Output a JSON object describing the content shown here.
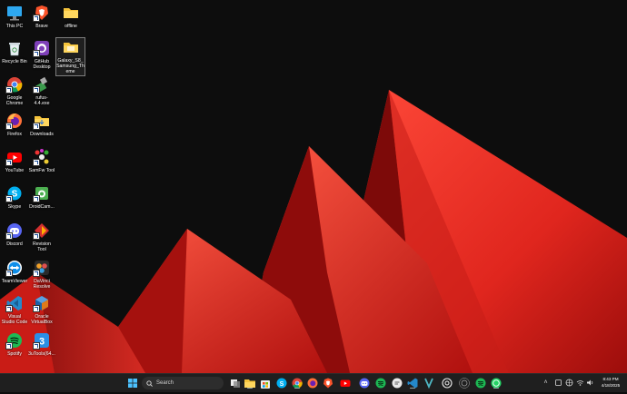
{
  "desktop": {
    "icons": [
      {
        "label": "This PC",
        "icon": "monitor-icon"
      },
      {
        "label": "Brave",
        "icon": "brave-icon"
      },
      {
        "label": "offline",
        "icon": "folder-icon"
      },
      {
        "label": "Recycle Bin",
        "icon": "recycle-bin-icon"
      },
      {
        "label": "GitHub Desktop",
        "icon": "github-icon"
      },
      {
        "label": "Galaxy_S8_Samsung_Theme",
        "icon": "folder-icon"
      },
      {
        "label": "Google Chrome",
        "icon": "chrome-icon"
      },
      {
        "label": "rufus-4.4.exe",
        "icon": "rufus-icon"
      },
      {
        "label": "Firefox",
        "icon": "firefox-icon"
      },
      {
        "label": "Downloads",
        "icon": "folder-icon"
      },
      {
        "label": "YouTube",
        "icon": "youtube-icon"
      },
      {
        "label": "SamFw Tool",
        "icon": "samfw-icon"
      },
      {
        "label": "Skype",
        "icon": "skype-icon"
      },
      {
        "label": "DroidCam...",
        "icon": "droidcam-icon"
      },
      {
        "label": "Discord",
        "icon": "discord-icon"
      },
      {
        "label": "Revision Tool",
        "icon": "revision-tool-icon"
      },
      {
        "label": "TeamViewer",
        "icon": "teamviewer-icon"
      },
      {
        "label": "DaVinci Resolve",
        "icon": "davinci-icon"
      },
      {
        "label": "Visual Studio Code",
        "icon": "vscode-icon"
      },
      {
        "label": "Oracle VirtualBox",
        "icon": "virtualbox-icon"
      },
      {
        "label": "Spotify",
        "icon": "spotify-icon"
      },
      {
        "label": "3uTools(64...",
        "icon": "3utools-icon"
      }
    ]
  },
  "taskbar": {
    "search_placeholder": "Search",
    "pinned": [
      "windows-start-icon",
      "task-view-icon",
      "file-explorer-icon",
      "store-icon",
      "skype-icon",
      "chrome-icon",
      "firefox-icon",
      "brave-icon",
      "youtube-icon",
      "discord-icon",
      "spotify-icon",
      "chat-icon",
      "vscode-icon",
      "media-icon",
      "chatgpt-icon",
      "spotify-icon",
      "whatsapp-icon"
    ],
    "tray": [
      "chevron-up-icon",
      "speaker-settings-icon",
      "network-icon",
      "wifi-icon",
      "volume-icon"
    ],
    "clock": {
      "time": "8:43 PM",
      "date": "4/18/2025"
    }
  },
  "colors": {
    "accent": "#e8322a",
    "background": "#0d0d0d",
    "taskbar": "#1f1f1f"
  }
}
